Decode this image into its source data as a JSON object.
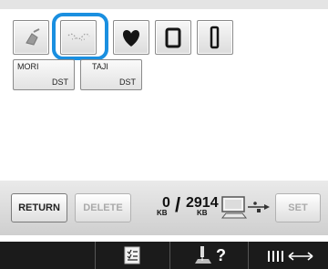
{
  "patterns": [
    {
      "icon": "embroidery-stitch-icon"
    },
    {
      "icon": "dotted-stitch-icon",
      "selected": true
    },
    {
      "icon": "heart-icon"
    },
    {
      "icon": "rectangle-frame-icon"
    },
    {
      "icon": "tall-rectangle-frame-icon"
    }
  ],
  "files": [
    {
      "name": "MORI",
      "ext": "DST"
    },
    {
      "name": "TAJI",
      "ext": "DST"
    }
  ],
  "controls": {
    "return_label": "RETURN",
    "delete_label": "DELETE",
    "set_label": "SET"
  },
  "memory": {
    "used": "0",
    "total": "2914",
    "unit": "KB"
  },
  "bottom_bar": {
    "help_label": "?"
  },
  "colors": {
    "selection": "#1a8fe0",
    "bottom_bar": "#1b1b1b"
  }
}
